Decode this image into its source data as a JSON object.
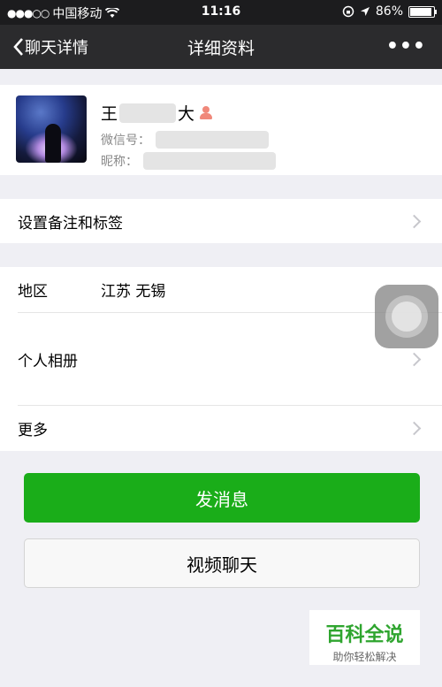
{
  "status_bar": {
    "signal_dots": "●●●○○",
    "carrier": "中国移动",
    "time": "11:16",
    "battery_text": "86%",
    "battery_level": 0.86
  },
  "nav": {
    "back_label": "聊天详情",
    "title": "详细资料",
    "more_label": "•••"
  },
  "profile": {
    "name_first": "王",
    "name_last": "大",
    "wechat_id_label": "微信号：",
    "nickname_label": "昵称："
  },
  "rows": {
    "remark_label": "设置备注和标签",
    "region_label": "地区",
    "region_value": "江苏 无锡",
    "album_label": "个人相册",
    "more_label": "更多"
  },
  "buttons": {
    "send_message": "发消息",
    "video_chat": "视频聊天"
  },
  "watermark": {
    "title": "百科全说",
    "subtitle": "助你轻松解决"
  },
  "colors": {
    "accent_green": "#1aad19",
    "nav_bg": "#2b2b2d",
    "page_bg": "#efeff4"
  }
}
